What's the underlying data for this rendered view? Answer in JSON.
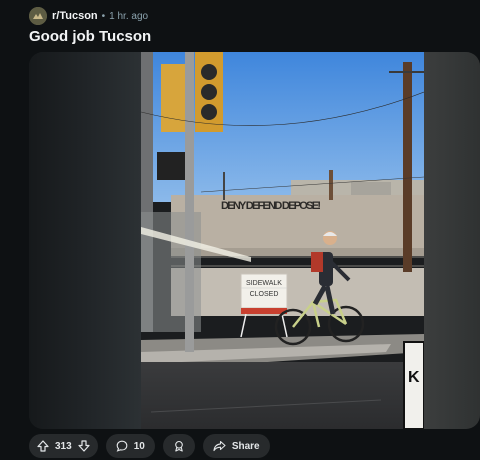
{
  "post": {
    "subreddit": "r/Tucson",
    "separator": "•",
    "time": "1 hr. ago",
    "title": "Good job Tucson"
  },
  "photo": {
    "wall_graffiti": "DENY DEFEND DEPOSE!",
    "sign_line1": "SIDEWALK",
    "sign_line2": "CLOSED",
    "corner_sign_letter": "K"
  },
  "actions": {
    "vote_count": "313",
    "comment_count": "10",
    "share_label": "Share"
  },
  "icons": {
    "upvote": "arrow-up-outline",
    "downvote": "arrow-down-outline",
    "comment": "speech-bubble",
    "award": "award-ribbon",
    "share": "share-arrow"
  },
  "colors": {
    "page_bg": "#0e1113",
    "button_bg": "#272a2c",
    "sky": "#4d8fe0"
  }
}
